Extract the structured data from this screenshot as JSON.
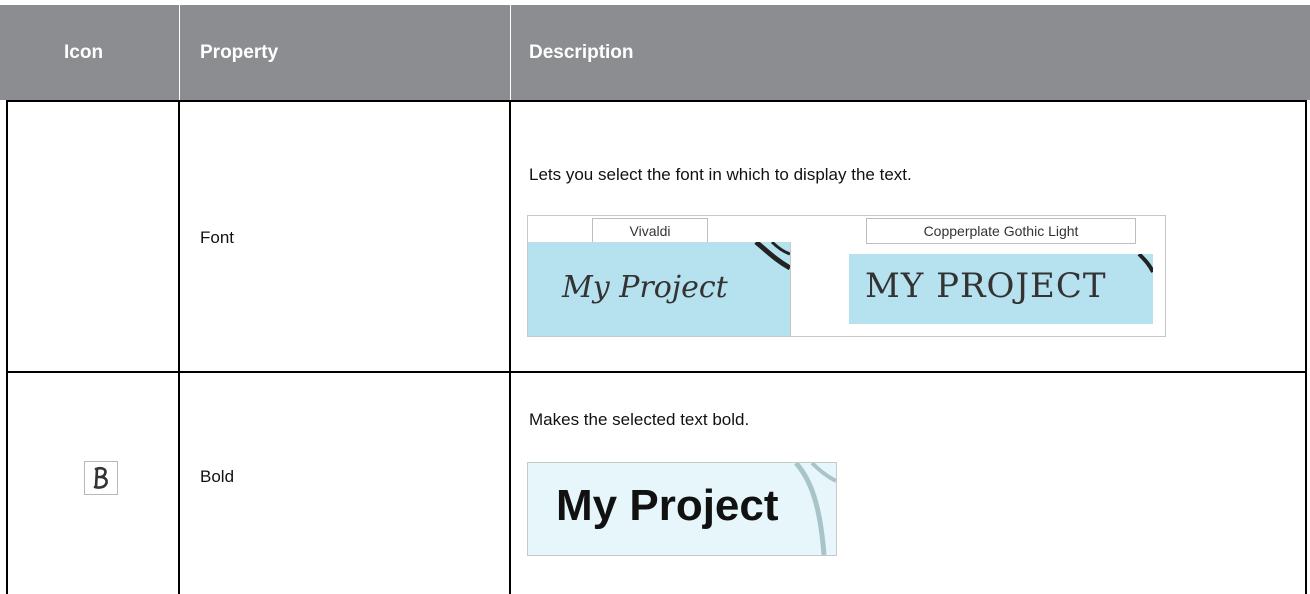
{
  "table": {
    "headers": [
      "Icon",
      "Property",
      "Description"
    ],
    "rows": [
      {
        "icon": "",
        "property": "Font",
        "description": "Lets you select the font in which to display the text.",
        "example": {
          "label_left": "Vivaldi",
          "label_right": "Copperplate Gothic Light",
          "sample_left": "My Project",
          "sample_right": "My Project"
        }
      },
      {
        "icon": "bold-b-icon",
        "property": "Bold",
        "description": "Makes the selected text bold.",
        "example": {
          "sample": "My Project"
        }
      }
    ]
  },
  "colors": {
    "header_bg": "#8c8d91",
    "header_text": "#ffffff",
    "sample_bg": "#b6e2ef"
  }
}
